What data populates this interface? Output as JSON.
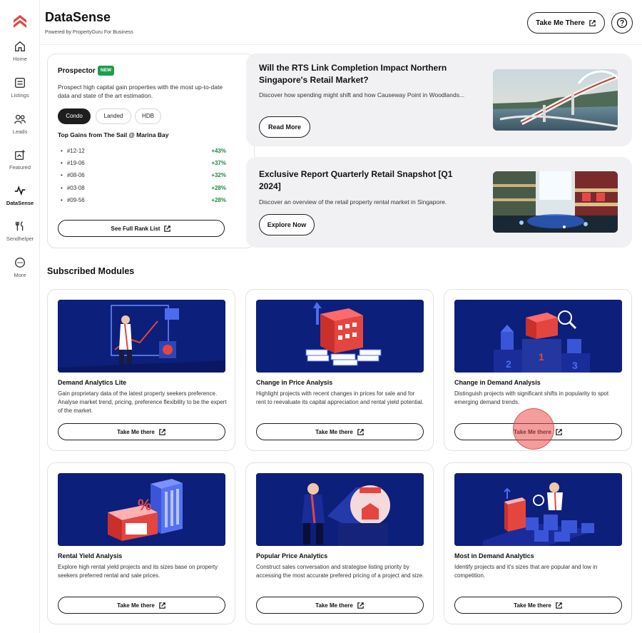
{
  "brand": {
    "logo": "propertyguru-logo",
    "accent": "#e4463f",
    "green": "#1e9e4a",
    "navy": "#0c1f7a"
  },
  "sidebar": {
    "items": [
      {
        "label": "Home",
        "icon": "home-icon",
        "active": false
      },
      {
        "label": "Listings",
        "icon": "listings-icon",
        "active": false
      },
      {
        "label": "Leads",
        "icon": "leads-icon",
        "active": false
      },
      {
        "label": "Featured",
        "icon": "featured-icon",
        "active": false
      },
      {
        "label": "DataSense",
        "icon": "datasense-icon",
        "active": true
      },
      {
        "label": "Sendhelper",
        "icon": "sendhelper-icon",
        "active": false
      },
      {
        "label": "More",
        "icon": "more-icon",
        "active": false
      }
    ]
  },
  "header": {
    "title": "DataSense",
    "subtitle": "Powered by PropertyGuru For Business",
    "cta_label": "Take Me There",
    "help_icon": "help-icon"
  },
  "prospector": {
    "title": "Prospector",
    "badge": "NEW",
    "description": "Prospect high capital gain properties with the most up-to-date data and state of the art estimation.",
    "chips": [
      "Condo",
      "Landed",
      "HDB"
    ],
    "active_chip": "Condo",
    "subheading": "Top Gains from The Sail @ Marina Bay",
    "gains": [
      {
        "unit": "#12-12",
        "pct": "+43%"
      },
      {
        "unit": "#19-06",
        "pct": "+37%"
      },
      {
        "unit": "#08-06",
        "pct": "+32%"
      },
      {
        "unit": "#03-08",
        "pct": "+28%"
      },
      {
        "unit": "#09-56",
        "pct": "+28%"
      }
    ],
    "rank_button": "See Full Rank List"
  },
  "promos": [
    {
      "title": "Will the RTS Link Completion Impact Northern Singapore's Retail Market?",
      "description": "Discover how spending might shift and how Causeway Point in Woodlands...",
      "button": "Read More"
    },
    {
      "title": "Exclusive Report Quarterly Retail Snapshot [Q1 2024]",
      "description": "Discover an overview of the retail property rental market in Singapore.",
      "button": "Explore Now"
    }
  ],
  "modules": {
    "section_title": "Subscribed Modules",
    "items": [
      {
        "title": "Demand Analytics Lite",
        "description": "Gain proprietary data of the latest property seekers preference. Analyse market trend, pricing, preference flexibility to be the expert of the market.",
        "button": "Take Me there"
      },
      {
        "title": "Change in Price Analysis",
        "description": "Highlight projects with recent changes in prices for sale and for rent to reevaluate its capital appreciation and rental yield potential.",
        "button": "Take Me there"
      },
      {
        "title": "Change in Demand Analysis",
        "description": "Distinguish projects with significant shifts in popularity to spot emerging demand trends.",
        "button": "Take Me there"
      },
      {
        "title": "Rental Yield Analysis",
        "description": "Explore high rental yield projects and its sizes base on property seekers preferred rental and sale prices.",
        "button": "Take Me there"
      },
      {
        "title": "Popular Price Analytics",
        "description": "Construct sales conversation and strategise listing priority by accessing the most accurate prefered pricing of a project and size.",
        "button": "Take Me there"
      },
      {
        "title": "Most in Demand Analytics",
        "description": "Identify projects and it's sizes that are popular and low in competition.",
        "button": "Take Me there"
      }
    ]
  }
}
